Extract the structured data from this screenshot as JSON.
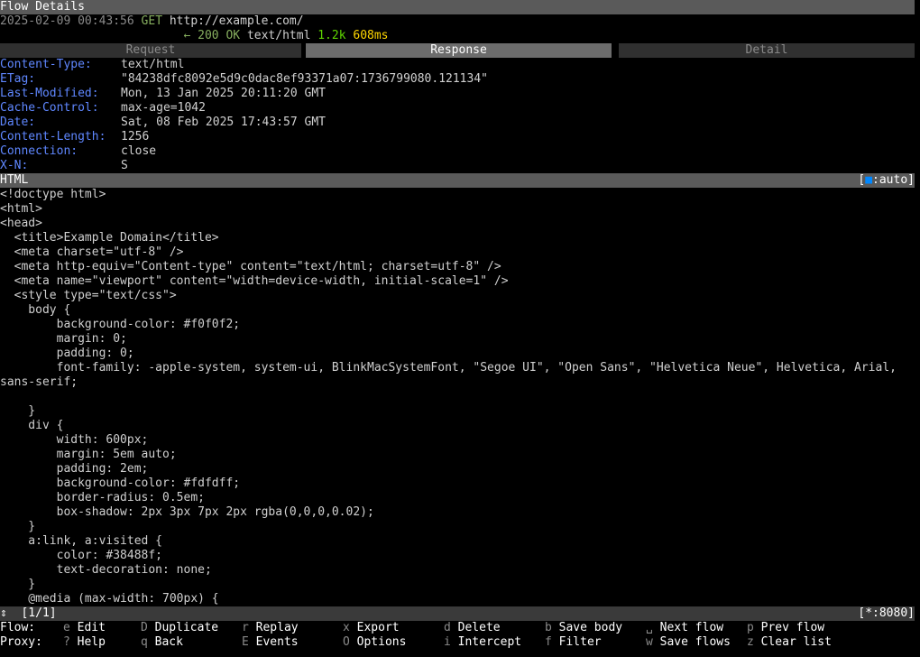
{
  "title": "Flow Details",
  "request_line": {
    "timestamp": "2025-02-09 00:43:56",
    "method": "GET",
    "url": "http://example.com/"
  },
  "response_line": {
    "arrow": "←",
    "status": "200 OK",
    "content_type": "text/html",
    "size": "1.2k",
    "duration": "608ms"
  },
  "tabs": [
    "Request",
    "Response",
    "Detail"
  ],
  "headers": [
    {
      "key": "Content-Type:",
      "value": "text/html"
    },
    {
      "key": "ETag:",
      "value": "\"84238dfc8092e5d9c0dac8ef93371a07:1736799080.121134\""
    },
    {
      "key": "Last-Modified:",
      "value": "Mon, 13 Jan 2025 20:11:20 GMT"
    },
    {
      "key": "Cache-Control:",
      "value": "max-age=1042"
    },
    {
      "key": "Date:",
      "value": "Sat, 08 Feb 2025 17:43:57 GMT"
    },
    {
      "key": "Content-Length:",
      "value": "1256"
    },
    {
      "key": "Connection:",
      "value": "close"
    },
    {
      "key": "X-N:",
      "value": "S"
    }
  ],
  "body_section": {
    "label": "HTML",
    "view_mode_prefix": "[",
    "view_mode": ":auto]"
  },
  "code_lines": [
    "<!doctype html>",
    "<html>",
    "<head>",
    "  <title>Example Domain</title>",
    "  <meta charset=\"utf-8\" />",
    "  <meta http-equiv=\"Content-type\" content=\"text/html; charset=utf-8\" />",
    "  <meta name=\"viewport\" content=\"width=device-width, initial-scale=1\" />",
    "  <style type=\"text/css\">",
    "    body {",
    "        background-color: #f0f0f2;",
    "        margin: 0;",
    "        padding: 0;",
    "        font-family: -apple-system, system-ui, BlinkMacSystemFont, \"Segoe UI\", \"Open Sans\", \"Helvetica Neue\", Helvetica, Arial,",
    "sans-serif;",
    "",
    "    }",
    "    div {",
    "        width: 600px;",
    "        margin: 5em auto;",
    "        padding: 2em;",
    "        background-color: #fdfdff;",
    "        border-radius: 0.5em;",
    "        box-shadow: 2px 3px 7px 2px rgba(0,0,0,0.02);",
    "    }",
    "    a:link, a:visited {",
    "        color: #38488f;",
    "        text-decoration: none;",
    "    }",
    "    @media (max-width: 700px) {"
  ],
  "statusbar": {
    "arrow": "⇕",
    "position": "[1/1]",
    "listen": "[*:8080]"
  },
  "footer": {
    "rows": [
      {
        "label": "Flow:",
        "items": [
          {
            "key": "e",
            "action": "Edit"
          },
          {
            "key": "D",
            "action": "Duplicate"
          },
          {
            "key": "r",
            "action": "Replay"
          },
          {
            "key": "x",
            "action": "Export"
          },
          {
            "key": "d",
            "action": "Delete"
          },
          {
            "key": "b",
            "action": "Save body"
          },
          {
            "key": "space",
            "action": "Next flow"
          },
          {
            "key": "p",
            "action": "Prev flow"
          }
        ]
      },
      {
        "label": "Proxy:",
        "items": [
          {
            "key": "?",
            "action": "Help"
          },
          {
            "key": "q",
            "action": "Back"
          },
          {
            "key": "E",
            "action": "Events"
          },
          {
            "key": "O",
            "action": "Options"
          },
          {
            "key": "i",
            "action": "Intercept"
          },
          {
            "key": "f",
            "action": "Filter"
          },
          {
            "key": "w",
            "action": "Save flows"
          },
          {
            "key": "z",
            "action": "Clear list"
          }
        ]
      }
    ]
  },
  "colors": {
    "background": "#000000",
    "header_key": "#5f87ff",
    "status_ok": "#87af5f",
    "size": "#5fd700",
    "duration": "#ffd700"
  }
}
